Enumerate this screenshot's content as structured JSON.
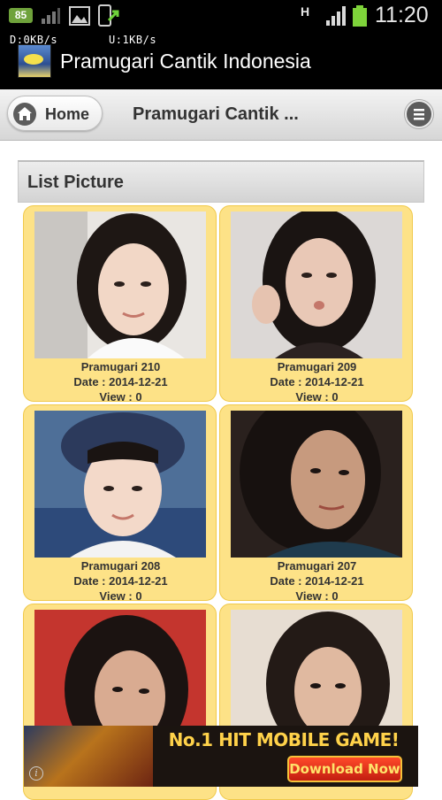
{
  "status_bar": {
    "battery_badge": "85",
    "time": "11:20",
    "network_type": "H"
  },
  "app_bar": {
    "download_speed": "D:0KB/s",
    "upload_speed": "U:1KB/s",
    "title": "Pramugari Cantik Indonesia"
  },
  "header": {
    "home_label": "Home",
    "title": "Pramugari Cantik ..."
  },
  "section": {
    "title": "List Picture"
  },
  "cards": [
    {
      "name": "Pramugari 210",
      "date": "Date : 2014-12-21",
      "views": "View : 0"
    },
    {
      "name": "Pramugari 209",
      "date": "Date : 2014-12-21",
      "views": "View : 0"
    },
    {
      "name": "Pramugari 208",
      "date": "Date : 2014-12-21",
      "views": "View : 0"
    },
    {
      "name": "Pramugari 207",
      "date": "Date : 2014-12-21",
      "views": "View : 0"
    },
    {
      "name": "",
      "date": "",
      "views": ""
    },
    {
      "name": "",
      "date": "",
      "views": ""
    }
  ],
  "ad": {
    "headline": "No.1 HIT MOBILE GAME!",
    "cta": "Download Now",
    "info_glyph": "i"
  },
  "colors": {
    "card_background": "#fde287",
    "card_border": "#f0c94b",
    "header_gradient_top": "#f3f3f3",
    "header_gradient_bottom": "#d6d6d6",
    "app_bar": "#000000",
    "battery_green": "#6fa23b",
    "ad_cta_red": "#c21d10"
  },
  "icons": {
    "home": "home-icon",
    "menu": "menu-icon",
    "battery": "battery-icon",
    "signal": "signal-icon",
    "gallery": "gallery-icon",
    "phone_update": "phone-icon",
    "ad_info": "info-icon"
  }
}
